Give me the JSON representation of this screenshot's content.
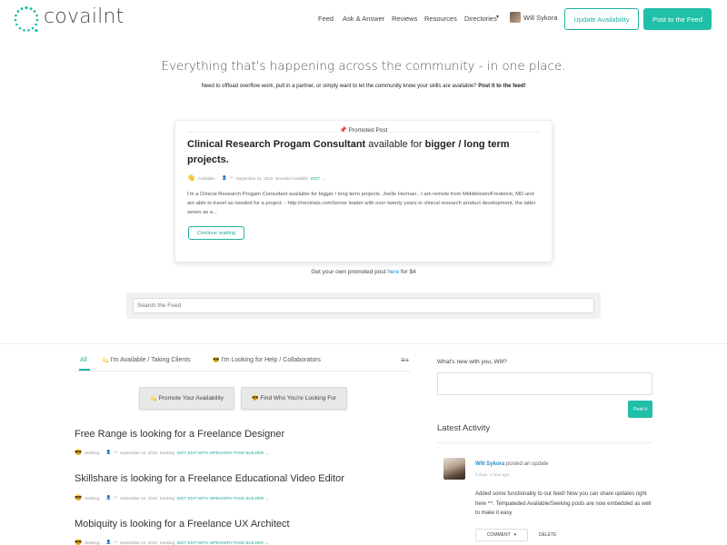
{
  "header": {
    "brand": "covailnt",
    "nav": [
      "Feed",
      "Ask & Answer",
      "Reviews",
      "Resources",
      "Directories"
    ],
    "directories_caret": "▾",
    "user_name": "Will Sykora",
    "update_availability": "Update Availability",
    "post_to_feed": "Post to the Feed",
    "accent_color": "#20bfa8"
  },
  "hero": {
    "title": "Everything that's happening across the community - in one place.",
    "subtitle": "Need to offload overflow work, pull in a partner, or simply want to let the community know your skills are available?",
    "subtitle_bold": "Post it to the feed!"
  },
  "promoted": {
    "label": "Promoted Post",
    "title_bold_1": "Clinical Research Progam Consultant",
    "title_mid": " available for ",
    "title_bold_2": "bigger / long term projects.",
    "meta_status": "Available,",
    "meta_date": "September 21, 2018",
    "meta_boosted": "Boosted Available",
    "meta_edit": "EDIT →",
    "body": "I'm a Clinical Research Progam Consultant available for bigger / long term projects. Joelle Herman , I am remote from Middletown/Frederick, MD and am able to travel as needed for a project. - http://nectrials.comSenior leader with over twenty years in clinical research product development, the latter seven as a...",
    "continue": "Continue reading"
  },
  "get_own": {
    "prefix": "Get your own promoted post",
    "link": "here",
    "suffix": "for $4"
  },
  "search": {
    "placeholder": "Search the Feed"
  },
  "tabs": {
    "all": "All",
    "available": "I'm Available / Taking Clients",
    "looking": "I'm Looking for Help / Collaborators"
  },
  "actions": {
    "promote": "Promote Your Availability",
    "find": "Find Who You're Looking For"
  },
  "posts": [
    {
      "title": "Free Range is looking for a Freelance Designer",
      "status": "Seeking,",
      "date": "September 24, 2018",
      "tag": "Seeking",
      "edit": "EDIT EDIT WITH WPBAKERY PAGE BUILDER →"
    },
    {
      "title": "Skillshare is looking for a Freelance Educational Video Editor",
      "status": "Seeking,",
      "date": "September 24, 2018",
      "tag": "Seeking",
      "edit": "EDIT EDIT WITH WPBAKERY PAGE BUILDER →"
    },
    {
      "title": "Mobiquity is looking for a Freelance UX Architect",
      "status": "Seeking,",
      "date": "September 24, 2018",
      "tag": "Seeking",
      "edit": "EDIT EDIT WITH WPBAKERY PAGE BUILDER →"
    }
  ],
  "sidebar": {
    "whats_new": "What's new with you, Will?",
    "post_it": "Post it",
    "latest_activity": "Latest Activity",
    "activity": {
      "name": "Will Sykora",
      "action": "posted an update",
      "time": "3 days, 1 hour ago",
      "body": "Added some functionality to our feed! Now you can share updates right here ^^. Tempateded Available/Seeking posts are now embedded as well to make it easy",
      "comment": "COMMENT",
      "delete": "DELETE"
    }
  }
}
